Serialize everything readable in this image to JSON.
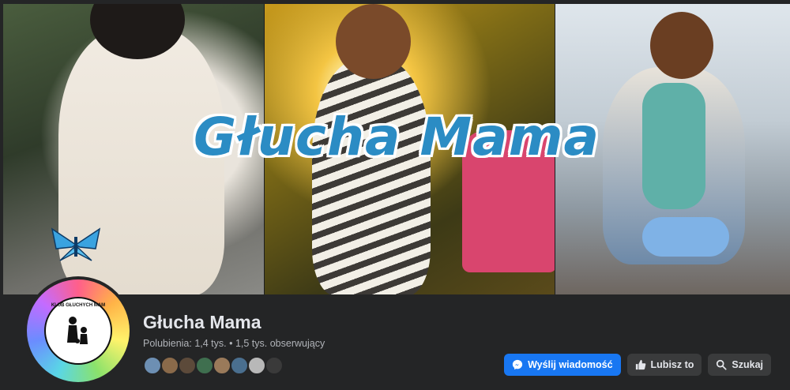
{
  "cover": {
    "title": "Głucha Mama"
  },
  "avatar": {
    "ring_text": "KLUB GŁUCHYCH MAM"
  },
  "page": {
    "name": "Głucha Mama",
    "stats": "Polubienia: 1,4 tys. • 1,5 tys. obserwujący"
  },
  "friends": [
    "#6d8fb3",
    "#8a6a4a",
    "#5c4a3a",
    "#3f6f4f",
    "#9a7a5a",
    "#4a6f8f",
    "#b8b8b8",
    "#3a3a3a"
  ],
  "actions": {
    "message": "Wyślij wiadomość",
    "like": "Lubisz to",
    "search": "Szukaj"
  },
  "colors": {
    "accent": "#1877f2",
    "background": "#242526",
    "title": "#2b8cc4"
  }
}
